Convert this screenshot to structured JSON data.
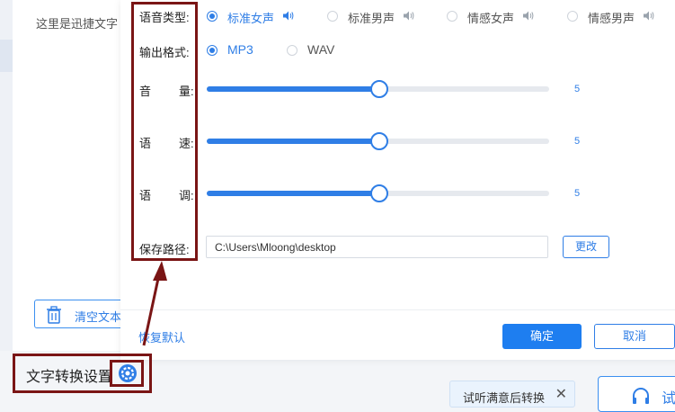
{
  "editor": {
    "placeholder": "这里是迅捷文字",
    "clear_button_label": "清空文本"
  },
  "bottom": {
    "setting_label": "文字转换设置",
    "tooltip_text": "试听满意后转换",
    "tooltip_close": "✕",
    "listen_button_partial": "试"
  },
  "dialog": {
    "voice_type": {
      "label": "语音类型:",
      "options": [
        "标准女声",
        "标准男声",
        "情感女声",
        "情感男声"
      ],
      "selected_index": 0
    },
    "output_format": {
      "label": "输出格式:",
      "options": [
        "MP3",
        "WAV"
      ],
      "selected_index": 0
    },
    "volume": {
      "label_a": "音",
      "label_b": "量:",
      "value": "5",
      "level_fraction": 0.5
    },
    "speed": {
      "label_a": "语",
      "label_b": "速:",
      "value": "5",
      "level_fraction": 0.5
    },
    "pitch": {
      "label_a": "语",
      "label_b": "调:",
      "value": "5",
      "level_fraction": 0.5
    },
    "save_path": {
      "label": "保存路径:",
      "value": "C:\\Users\\Mloong\\desktop",
      "change_button": "更改"
    },
    "reset_label": "恢复默认",
    "ok_label": "确定",
    "cancel_label": "取消"
  },
  "colors": {
    "accent": "#2f7ee6",
    "annotation": "#7a1515"
  }
}
